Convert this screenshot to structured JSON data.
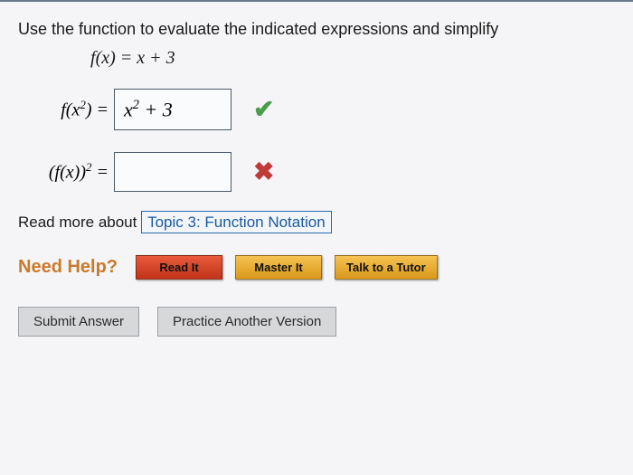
{
  "instruction": "Use the function to evaluate the indicated expressions and simplify",
  "given_function": "f(x) = x + 3",
  "rows": [
    {
      "lhs_html": "f(x²) =",
      "answer": "x² + 3",
      "status": "correct"
    },
    {
      "lhs_html": "(f(x))² =",
      "answer": "",
      "status": "incorrect"
    }
  ],
  "read_more": {
    "prefix": "Read more about ",
    "link_text": "Topic 3: Function Notation"
  },
  "help": {
    "label": "Need Help?",
    "buttons": {
      "read": "Read It",
      "master": "Master It",
      "tutor": "Talk to a Tutor"
    }
  },
  "bottom": {
    "submit": "Submit Answer",
    "practice": "Practice Another Version"
  }
}
